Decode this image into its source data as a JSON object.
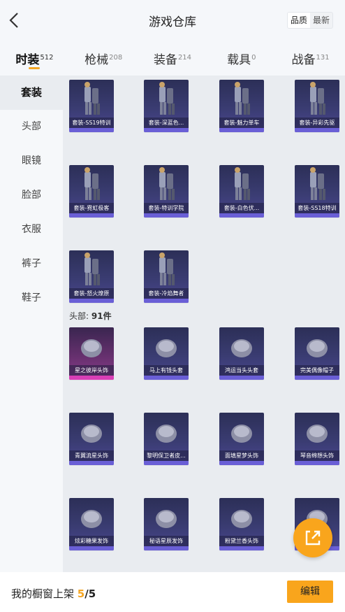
{
  "header": {
    "title": "游戏仓库",
    "sort": [
      "品质",
      "最新"
    ]
  },
  "tabs": [
    {
      "label": "时装",
      "count": "512"
    },
    {
      "label": "枪械",
      "count": "208"
    },
    {
      "label": "装备",
      "count": "214"
    },
    {
      "label": "载具",
      "count": "0"
    },
    {
      "label": "战备",
      "count": "131"
    }
  ],
  "sidebar": [
    "套装",
    "头部",
    "眼镜",
    "脸部",
    "衣服",
    "裤子",
    "鞋子"
  ],
  "suits": [
    {
      "name": "套装-SS19特训"
    },
    {
      "name": "套装-深蓝色..."
    },
    {
      "name": "套装-魅力单车"
    },
    {
      "name": "套装-异彩先驱"
    },
    {
      "name": "套装-霓虹极客"
    },
    {
      "name": "套装-特训学院"
    },
    {
      "name": "套装-白色伏..."
    },
    {
      "name": "套装-SS18特训"
    },
    {
      "name": "套装-怒火燎原"
    },
    {
      "name": "套装-冷焰舞者"
    }
  ],
  "head_section": {
    "label": "头部:",
    "count": "91件"
  },
  "heads": [
    {
      "name": "星之彼岸头饰"
    },
    {
      "name": "马上有钱头套"
    },
    {
      "name": "鸿运当头头套"
    },
    {
      "name": "完美偶像帽子"
    },
    {
      "name": "青翼流星头饰"
    },
    {
      "name": "黎明保卫者皮..."
    },
    {
      "name": "面填星梦头饰"
    },
    {
      "name": "琴音绵想头饰"
    },
    {
      "name": "炫彩糖果发饰"
    },
    {
      "name": "秘语星辰发饰"
    },
    {
      "name": "粉黛兰香头饰"
    },
    {
      "name": ""
    }
  ],
  "footer": {
    "label": "我的橱窗上架",
    "current": "5",
    "sep": "/",
    "total": "5",
    "edit": "编辑"
  },
  "colors": {
    "accent": "#f9a51c",
    "card_bar": "#6a5fd6",
    "card_bar_rare": "#d93fb6"
  }
}
